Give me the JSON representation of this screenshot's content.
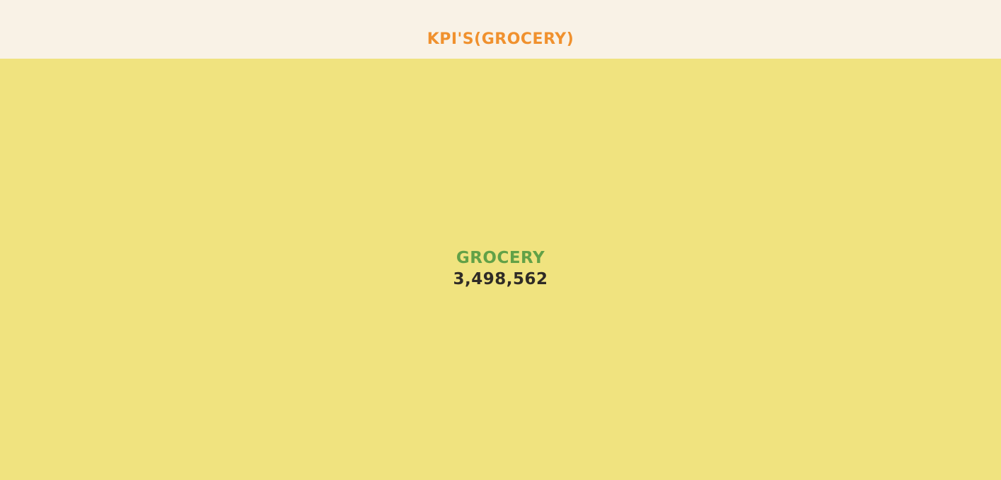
{
  "chart_data": {
    "type": "treemap",
    "title": "KPI'S(GROCERY)",
    "items": [
      {
        "name": "GROCERY",
        "value": 3498562,
        "value_label": "3,498,562"
      }
    ]
  },
  "colors": {
    "background": "#f9f2e6",
    "title": "#f0912e",
    "tile": "#f0e37f",
    "tile_label": "#62a147",
    "tile_value": "#2f2b26"
  }
}
